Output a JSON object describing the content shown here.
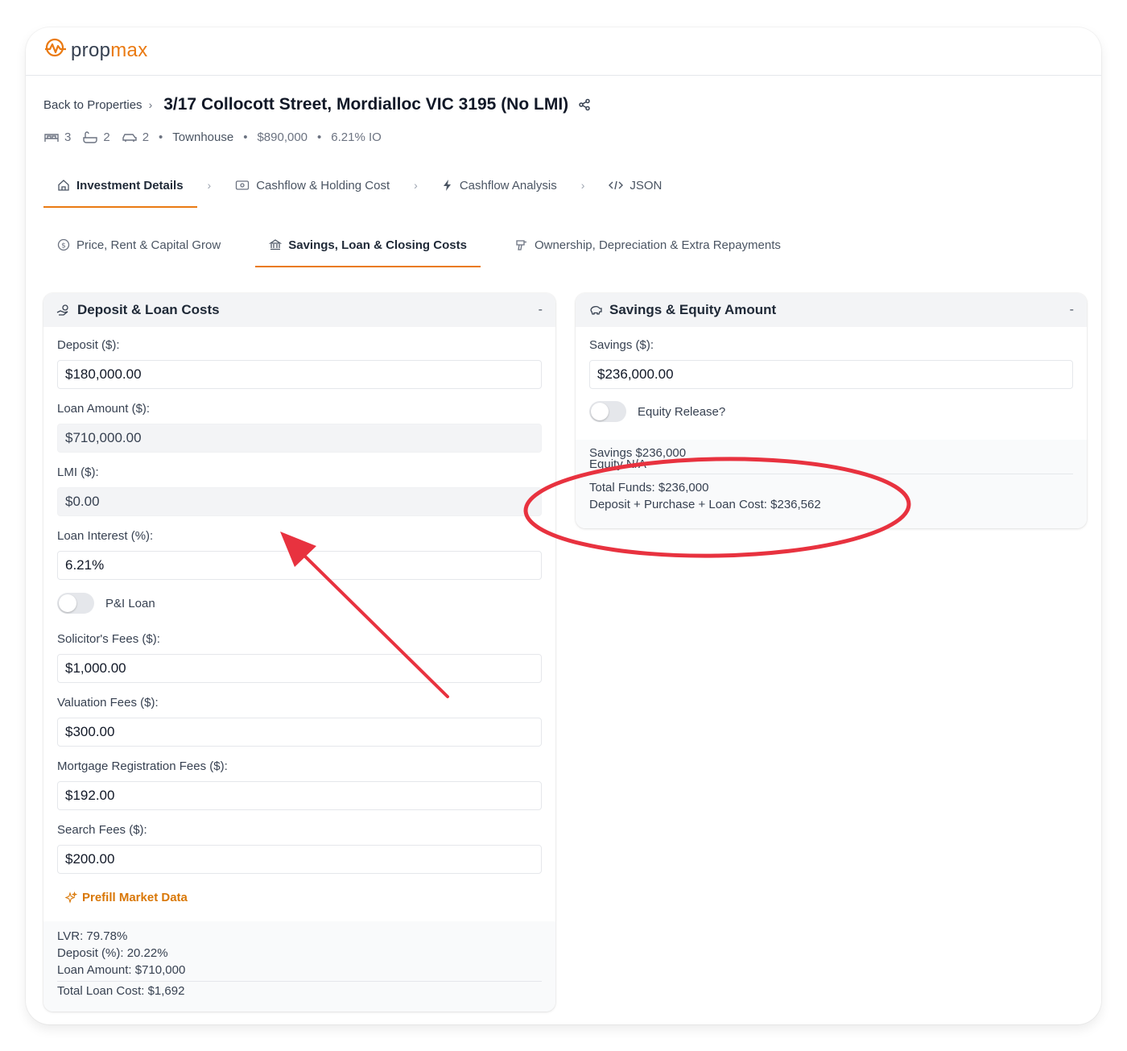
{
  "brand": {
    "name_prefix": "prop",
    "name_suffix": "max",
    "accent_color": "#ea7a12"
  },
  "breadcrumb": {
    "back_label": "Back to Properties"
  },
  "property": {
    "title": "3/17 Collocott Street, Mordialloc VIC 3195 (No LMI)",
    "bedrooms": "3",
    "bathrooms": "2",
    "car_spaces": "2",
    "type": "Townhouse",
    "price": "$890,000",
    "rate": "6.21% IO"
  },
  "main_tabs": [
    {
      "label": "Investment Details",
      "icon": "home-icon",
      "active": true
    },
    {
      "label": "Cashflow & Holding Cost",
      "icon": "cash-icon",
      "active": false
    },
    {
      "label": "Cashflow Analysis",
      "icon": "bolt-icon",
      "active": false
    },
    {
      "label": "JSON",
      "icon": "code-icon",
      "active": false
    }
  ],
  "sub_tabs": [
    {
      "label": "Price, Rent & Capital Grow",
      "icon": "dollar-circle-icon",
      "active": false
    },
    {
      "label": "Savings, Loan & Closing Costs",
      "icon": "bank-icon",
      "active": true
    },
    {
      "label": "Ownership, Depreciation & Extra Repayments",
      "icon": "drill-icon",
      "active": false
    }
  ],
  "deposit_card": {
    "title": "Deposit & Loan Costs",
    "collapse_label": "-",
    "fields": [
      {
        "label": "Deposit ($):",
        "value": "$180,000.00",
        "readonly": false
      },
      {
        "label": "Loan Amount ($):",
        "value": "$710,000.00",
        "readonly": true
      },
      {
        "label": "LMI ($):",
        "value": "$0.00",
        "readonly": true
      },
      {
        "label": "Loan Interest (%):",
        "value": "6.21%",
        "readonly": false
      }
    ],
    "pi_toggle": {
      "label": "P&I Loan",
      "on": false
    },
    "fees": [
      {
        "label": "Solicitor's Fees ($):",
        "value": "$1,000.00"
      },
      {
        "label": "Valuation Fees ($):",
        "value": "$300.00"
      },
      {
        "label": "Mortgage Registration Fees ($):",
        "value": "$192.00"
      },
      {
        "label": "Search Fees ($):",
        "value": "$200.00"
      }
    ],
    "prefill_label": "Prefill Market Data",
    "summary": {
      "lvr": "LVR: 79.78%",
      "deposit_pct": "Deposit (%): 20.22%",
      "loan_amount": "Loan Amount: $710,000",
      "total_loan_cost": "Total Loan Cost: $1,692"
    }
  },
  "savings_card": {
    "title": "Savings & Equity Amount",
    "collapse_label": "-",
    "savings_label": "Savings ($):",
    "savings_value": "$236,000.00",
    "equity_toggle": {
      "label": "Equity Release?",
      "on": false
    },
    "summary": {
      "savings": "Savings $236,000",
      "equity": "Equity N/A",
      "total_funds": "Total Funds: $236,000",
      "deposit_purchase_loan": "Deposit + Purchase + Loan Cost: $236,562"
    }
  },
  "annotation": {
    "color": "#e8323f"
  }
}
